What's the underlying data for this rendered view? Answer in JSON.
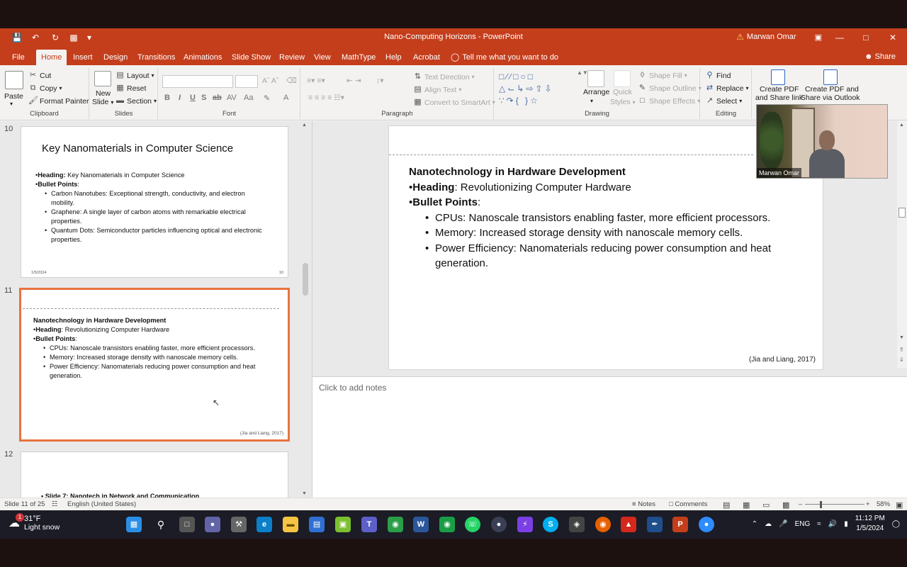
{
  "titlebar": {
    "doc_title": "Nano-Computing Horizons  -  PowerPoint",
    "user_name": "Marwan Omar"
  },
  "menu_tabs": [
    "File",
    "Home",
    "Insert",
    "Design",
    "Transitions",
    "Animations",
    "Slide Show",
    "Review",
    "View",
    "MathType",
    "Help",
    "Acrobat"
  ],
  "active_tab": "Home",
  "tell_me": "Tell me what you want to do",
  "share_label": "Share",
  "ribbon": {
    "clipboard": {
      "paste": "Paste",
      "cut": "Cut",
      "copy": "Copy",
      "format_painter": "Format Painter",
      "label": "Clipboard"
    },
    "slides": {
      "new_slide": "New",
      "new_slide2": "Slide",
      "layout": "Layout",
      "reset": "Reset",
      "section": "Section",
      "label": "Slides"
    },
    "font": {
      "label": "Font"
    },
    "paragraph": {
      "text_direction": "Text Direction",
      "align_text": "Align Text",
      "convert": "Convert to SmartArt",
      "label": "Paragraph"
    },
    "drawing": {
      "arrange": "Arrange",
      "quick_styles": "Quick",
      "quick_styles2": "Styles",
      "shape_fill": "Shape Fill",
      "shape_outline": "Shape Outline",
      "shape_effects": "Shape Effects",
      "label": "Drawing"
    },
    "editing": {
      "find": "Find",
      "replace": "Replace",
      "select": "Select",
      "label": "Editing"
    },
    "acrobat": {
      "create_pdf_link": "Create PDF",
      "create_pdf_link2": "and Share link",
      "create_pdf_outlook": "Create PDF and",
      "create_pdf_outlook2": "Share via Outlook"
    }
  },
  "thumbnails": {
    "slide10": {
      "num": "10",
      "title": "Key Nanomaterials in Computer Science",
      "heading_label": "Heading:",
      "heading_text": " Key Nanomaterials in Computer Science",
      "bullets_label": "Bullet Points",
      "items": [
        "Carbon Nanotubes: Exceptional strength, conductivity, and electron mobility.",
        "Graphene: A single layer of carbon atoms with remarkable electrical properties.",
        "Quantum Dots: Semiconductor particles influencing optical and electronic properties."
      ],
      "footer_date": "1/5/2024",
      "footer_num": "10"
    },
    "slide11": {
      "num": "11",
      "title": "Nanotechnology in Hardware Development",
      "heading_label": "Heading",
      "heading_text": ": Revolutionizing Computer Hardware",
      "bullets_label": "Bullet Points",
      "items": [
        "CPUs: Nanoscale transistors enabling faster, more efficient processors.",
        "Memory: Increased storage density with nanoscale memory cells.",
        "Power Efficiency: Nanomaterials reducing power consumption and heat generation."
      ],
      "cite": "(Jia and Liang, 2017)"
    },
    "slide12": {
      "num": "12",
      "partial_text": "• Slide 7: Nanotech in Network and Communication"
    }
  },
  "slide": {
    "title": "Nanotechnology in Hardware Development",
    "heading_label": "Heading",
    "heading_text": ": Revolutionizing Computer Hardware",
    "bullets_label": "Bullet Points",
    "items": [
      "CPUs: Nanoscale transistors enabling faster, more efficient processors.",
      "Memory: Increased storage density with nanoscale memory cells.",
      "Power Efficiency: Nanomaterials reducing power consumption and heat generation."
    ],
    "cite": "(Jia and Liang, 2017)"
  },
  "notes_placeholder": "Click to add notes",
  "webcam": {
    "name": "Marwan Omar"
  },
  "statusbar": {
    "slide_info": "Slide 11 of 25",
    "language": "English (United States)",
    "notes": "Notes",
    "comments": "Comments",
    "zoom": "58%"
  },
  "taskbar": {
    "temp": "31°F",
    "condition": "Light snow",
    "weather_badge": "1",
    "lang": "ENG",
    "time": "11:12 PM",
    "date": "1/5/2024"
  },
  "colors": {
    "accent": "#c43e1c",
    "selection": "#e8733f"
  }
}
